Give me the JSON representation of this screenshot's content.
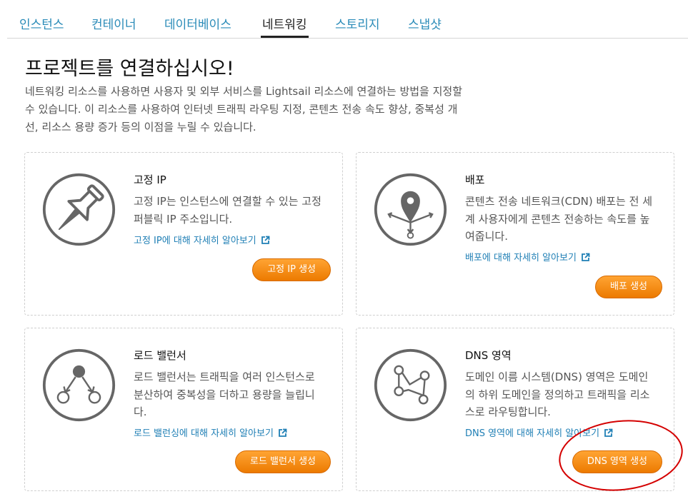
{
  "tabs": [
    {
      "label": "인스턴스"
    },
    {
      "label": "컨테이너"
    },
    {
      "label": "데이터베이스"
    },
    {
      "label": "네트워킹"
    },
    {
      "label": "스토리지"
    },
    {
      "label": "스냅샷"
    }
  ],
  "active_tab": "네트워킹",
  "page": {
    "title": "프로젝트를 연결하십시오!",
    "intro": "네트워킹 리소스를 사용하면 사용자 및 외부 서비스를 Lightsail 리소스에 연결하는 방법을 지정할 수 있습니다. 이 리소스를 사용하여 인터넷 트래픽 라우팅 지정, 콘텐츠 전송 속도 향상, 중복성 개선, 리소스 용량 증가 등의 이점을 누릴 수 있습니다."
  },
  "cards": [
    {
      "icon": "pushpin-icon",
      "title": "고정 IP",
      "description": "고정 IP는 인스턴스에 연결할 수 있는 고정 퍼블릭 IP 주소입니다.",
      "link": "고정 IP에 대해 자세히 알아보기",
      "button": "고정 IP 생성"
    },
    {
      "icon": "map-pin-icon",
      "title": "배포",
      "description": "콘텐츠 전송 네트워크(CDN) 배포는 전 세계 사용자에게 콘텐츠 전송하는 속도를 높여줍니다.",
      "link": "배포에 대해 자세히 알아보기",
      "button": "배포 생성"
    },
    {
      "icon": "load-balancer-icon",
      "title": "로드 밸런서",
      "description": "로드 밸런서는 트래픽을 여러 인스턴스로 분산하여 중복성을 더하고 용량을 늘립니다.",
      "link": "로드 밸런싱에 대해 자세히 알아보기",
      "button": "로드 밸런서 생성"
    },
    {
      "icon": "dns-nodes-icon",
      "title": "DNS 영역",
      "description": "도메인 이름 시스템(DNS) 영역은 도메인의 하위 도메인을 정의하고 트래픽을 리소스로 라우팅합니다.",
      "link": "DNS 영역에 대해 자세히 알아보기",
      "button": "DNS 영역 생성"
    }
  ],
  "colors": {
    "link": "#1f7fb5",
    "button_orange": "#ec7a00",
    "annotation_red": "#d40000"
  }
}
